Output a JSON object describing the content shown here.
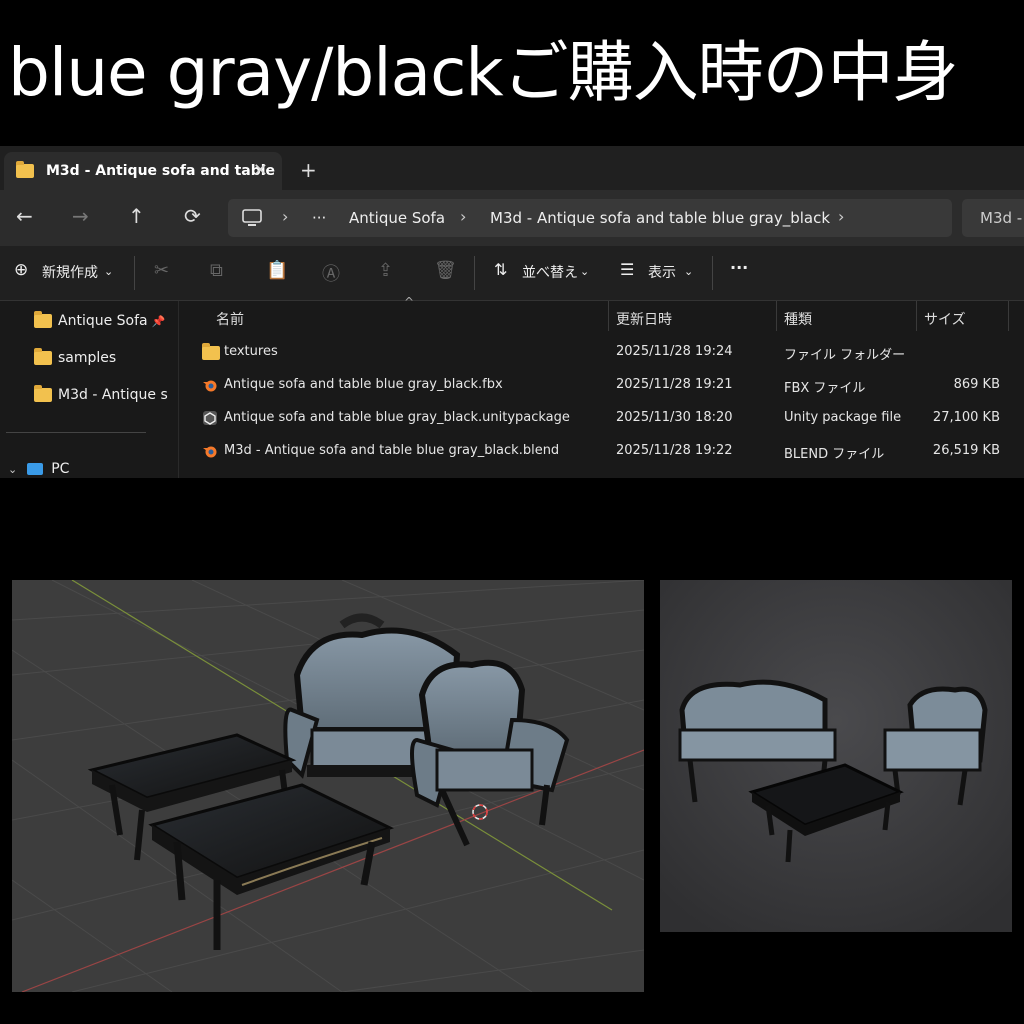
{
  "banner": {
    "title": "blue gray/blackご購入時の中身"
  },
  "tab": {
    "label": "M3d - Antique sofa and table",
    "close": "✕",
    "new": "+"
  },
  "nav": {
    "back": "←",
    "forward": "→",
    "up": "↑",
    "refresh": "⟳"
  },
  "address": {
    "ellipsis": "···",
    "crumbs": [
      "Antique Sofa",
      "M3d - Antique sofa and table blue gray_black"
    ],
    "search_text": "M3d -"
  },
  "toolbar": {
    "new_label": "新規作成",
    "sort_label": "並べ替え",
    "view_label": "表示",
    "more": "···"
  },
  "sidebar": {
    "items": [
      {
        "label": "Antique Sofa"
      },
      {
        "label": "samples"
      },
      {
        "label": "M3d - Antique s"
      }
    ],
    "pc_label": "PC"
  },
  "columns": {
    "name": "名前",
    "date": "更新日時",
    "type": "種類",
    "size": "サイズ"
  },
  "files": [
    {
      "name": "textures",
      "date": "2025/11/28 19:24",
      "type": "ファイル フォルダー",
      "size": "",
      "icon": "folder-icon"
    },
    {
      "name": "Antique sofa and table blue gray_black.fbx",
      "date": "2025/11/28 19:21",
      "type": "FBX ファイル",
      "size": "869 KB",
      "icon": "blender-icon"
    },
    {
      "name": "Antique sofa and table blue gray_black.unitypackage",
      "date": "2025/11/30 18:20",
      "type": "Unity package file",
      "size": "27,100 KB",
      "icon": "unity-icon"
    },
    {
      "name": "M3d - Antique sofa and table blue gray_black.blend",
      "date": "2025/11/28 19:22",
      "type": "BLEND ファイル",
      "size": "26,519 KB",
      "icon": "blender-icon"
    }
  ],
  "colors": {
    "sofa_fabric": "#7c8c99",
    "wood": "#1b1b1b",
    "viewport_bg": "#3d3d3d",
    "folder": "#f2c14e"
  }
}
